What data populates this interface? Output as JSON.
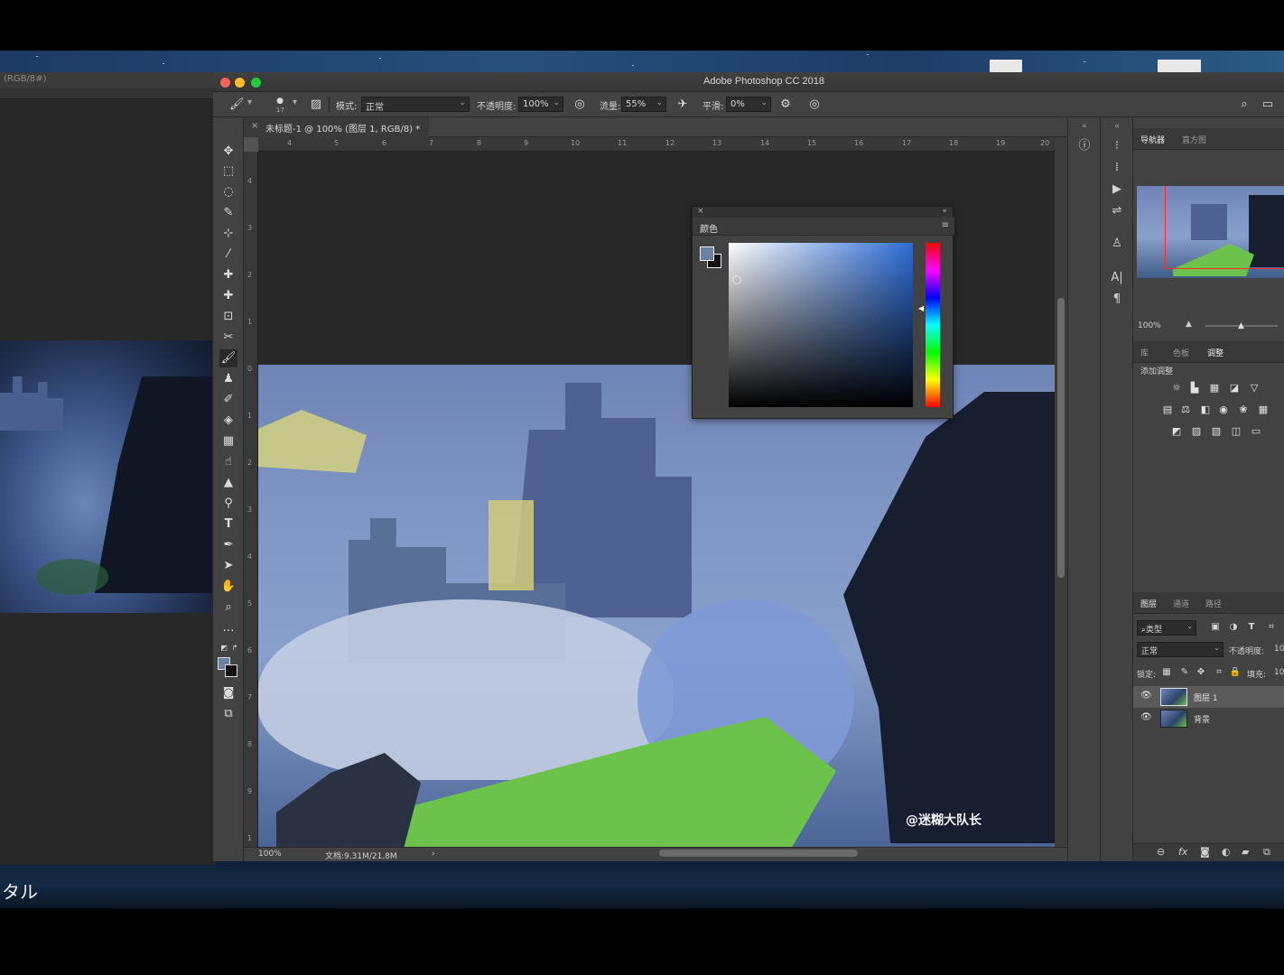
{
  "window": {
    "title": "Adobe Photoshop CC 2018"
  },
  "background_window": {
    "tab_label": "(RGB/8#)"
  },
  "desktop": {
    "caption": "タル"
  },
  "options_bar": {
    "brush_size": "17",
    "mode_label": "模式:",
    "mode_value": "正常",
    "opacity_label": "不透明度:",
    "opacity_value": "100%",
    "flow_label": "流量:",
    "flow_value": "55%",
    "smoothing_label": "平滑:",
    "smoothing_value": "0%"
  },
  "document": {
    "tab_title": "未标题-1 @ 100% (图层 1, RGB/8) *",
    "ruler_h_ticks": [
      "4",
      "5",
      "6",
      "7",
      "8",
      "9",
      "10",
      "11",
      "12",
      "13",
      "14",
      "15",
      "16",
      "17",
      "18",
      "19",
      "20"
    ],
    "ruler_v_ticks": [
      "4",
      "3",
      "2",
      "1",
      "0",
      "1",
      "2",
      "3",
      "4",
      "5",
      "6",
      "7",
      "8",
      "9",
      "1"
    ],
    "watermark": "@迷糊大队长",
    "status_zoom": "100%",
    "status_doc": "文档:9.31M/21.8M",
    "status_arrow": "›"
  },
  "color_panel": {
    "tab_label": "颜色",
    "foreground_color": "#6d82a3",
    "background_color": "#111111"
  },
  "navigator_panel": {
    "tabs": [
      {
        "label": "导航器",
        "active": true
      },
      {
        "label": "直方图",
        "active": false
      }
    ],
    "zoom": "100%"
  },
  "adjustments_panel": {
    "tabs": [
      {
        "label": "库",
        "active": false
      },
      {
        "label": "色板",
        "active": false
      },
      {
        "label": "调整",
        "active": true
      }
    ],
    "add_label": "添加调整"
  },
  "layers_panel": {
    "tabs": [
      {
        "label": "图层",
        "active": true
      },
      {
        "label": "通道",
        "active": false
      },
      {
        "label": "路径",
        "active": false
      }
    ],
    "filter_value": "类型",
    "blend_mode": "正常",
    "opacity_label": "不透明度:",
    "opacity_value": "10",
    "lock_label": "锁定:",
    "fill_label": "填充:",
    "fill_value": "10",
    "layers": [
      {
        "name": "图层 1",
        "selected": true
      },
      {
        "name": "背景",
        "selected": false
      }
    ]
  },
  "colors": {
    "accent_red_frame": "#ff2b2b",
    "panel_bg": "#424242"
  }
}
